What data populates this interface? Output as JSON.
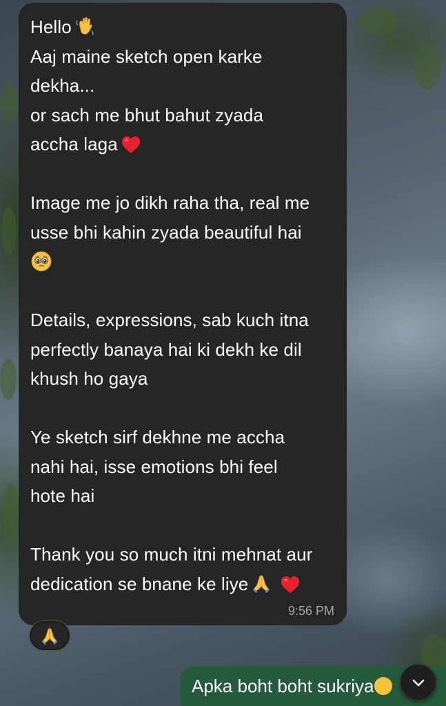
{
  "incoming_message": {
    "greeting": "Hello",
    "line_2": "Aaj maine sketch open karke",
    "line_3": "dekha...",
    "line_4": "or sach me bhut bahut zyada",
    "line_5": "accha laga",
    "para_2_line_1": "Image me jo dikh raha tha, real me",
    "para_2_line_2": "usse bhi kahin zyada beautiful hai",
    "para_3_line_1": "Details, expressions, sab kuch itna",
    "para_3_line_2": "perfectly banaya hai ki dekh ke dil",
    "para_3_line_3": "khush ho gaya",
    "para_4_line_1": "Ye sketch sirf dekhne me accha",
    "para_4_line_2": "nahi hai, isse emotions bhi feel",
    "para_4_line_3": "hote hai",
    "para_5_line_1": "Thank you so much itni mehnat aur",
    "para_5_line_2": "dedication se bnane ke liye",
    "time": "9:56 PM"
  },
  "reaction": {
    "icon": "folded-hands-emoji"
  },
  "outgoing_message": {
    "text": "Apka boht boht sukriya"
  },
  "icons": {
    "scroll_down": "chevron-down-icon"
  },
  "colors": {
    "incoming_bubble": "#262626",
    "outgoing_bubble": "#265a3c",
    "timestamp": "#a6a6a6"
  }
}
